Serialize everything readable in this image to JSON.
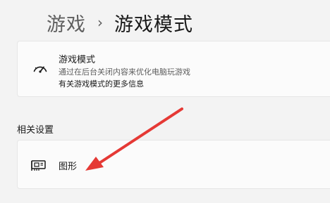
{
  "header": {
    "breadcrumb_parent": "游戏",
    "breadcrumb_separator": "›",
    "breadcrumb_current": "游戏模式"
  },
  "game_mode_card": {
    "icon": "gauge-icon",
    "title": "游戏模式",
    "description": "通过在后台关闭内容来优化电脑玩游戏",
    "link": "有关游戏模式的更多信息"
  },
  "related_settings": {
    "heading": "相关设置",
    "items": [
      {
        "icon": "graphics-card-icon",
        "label": "图形"
      }
    ]
  },
  "annotation": {
    "color": "#e53935"
  }
}
